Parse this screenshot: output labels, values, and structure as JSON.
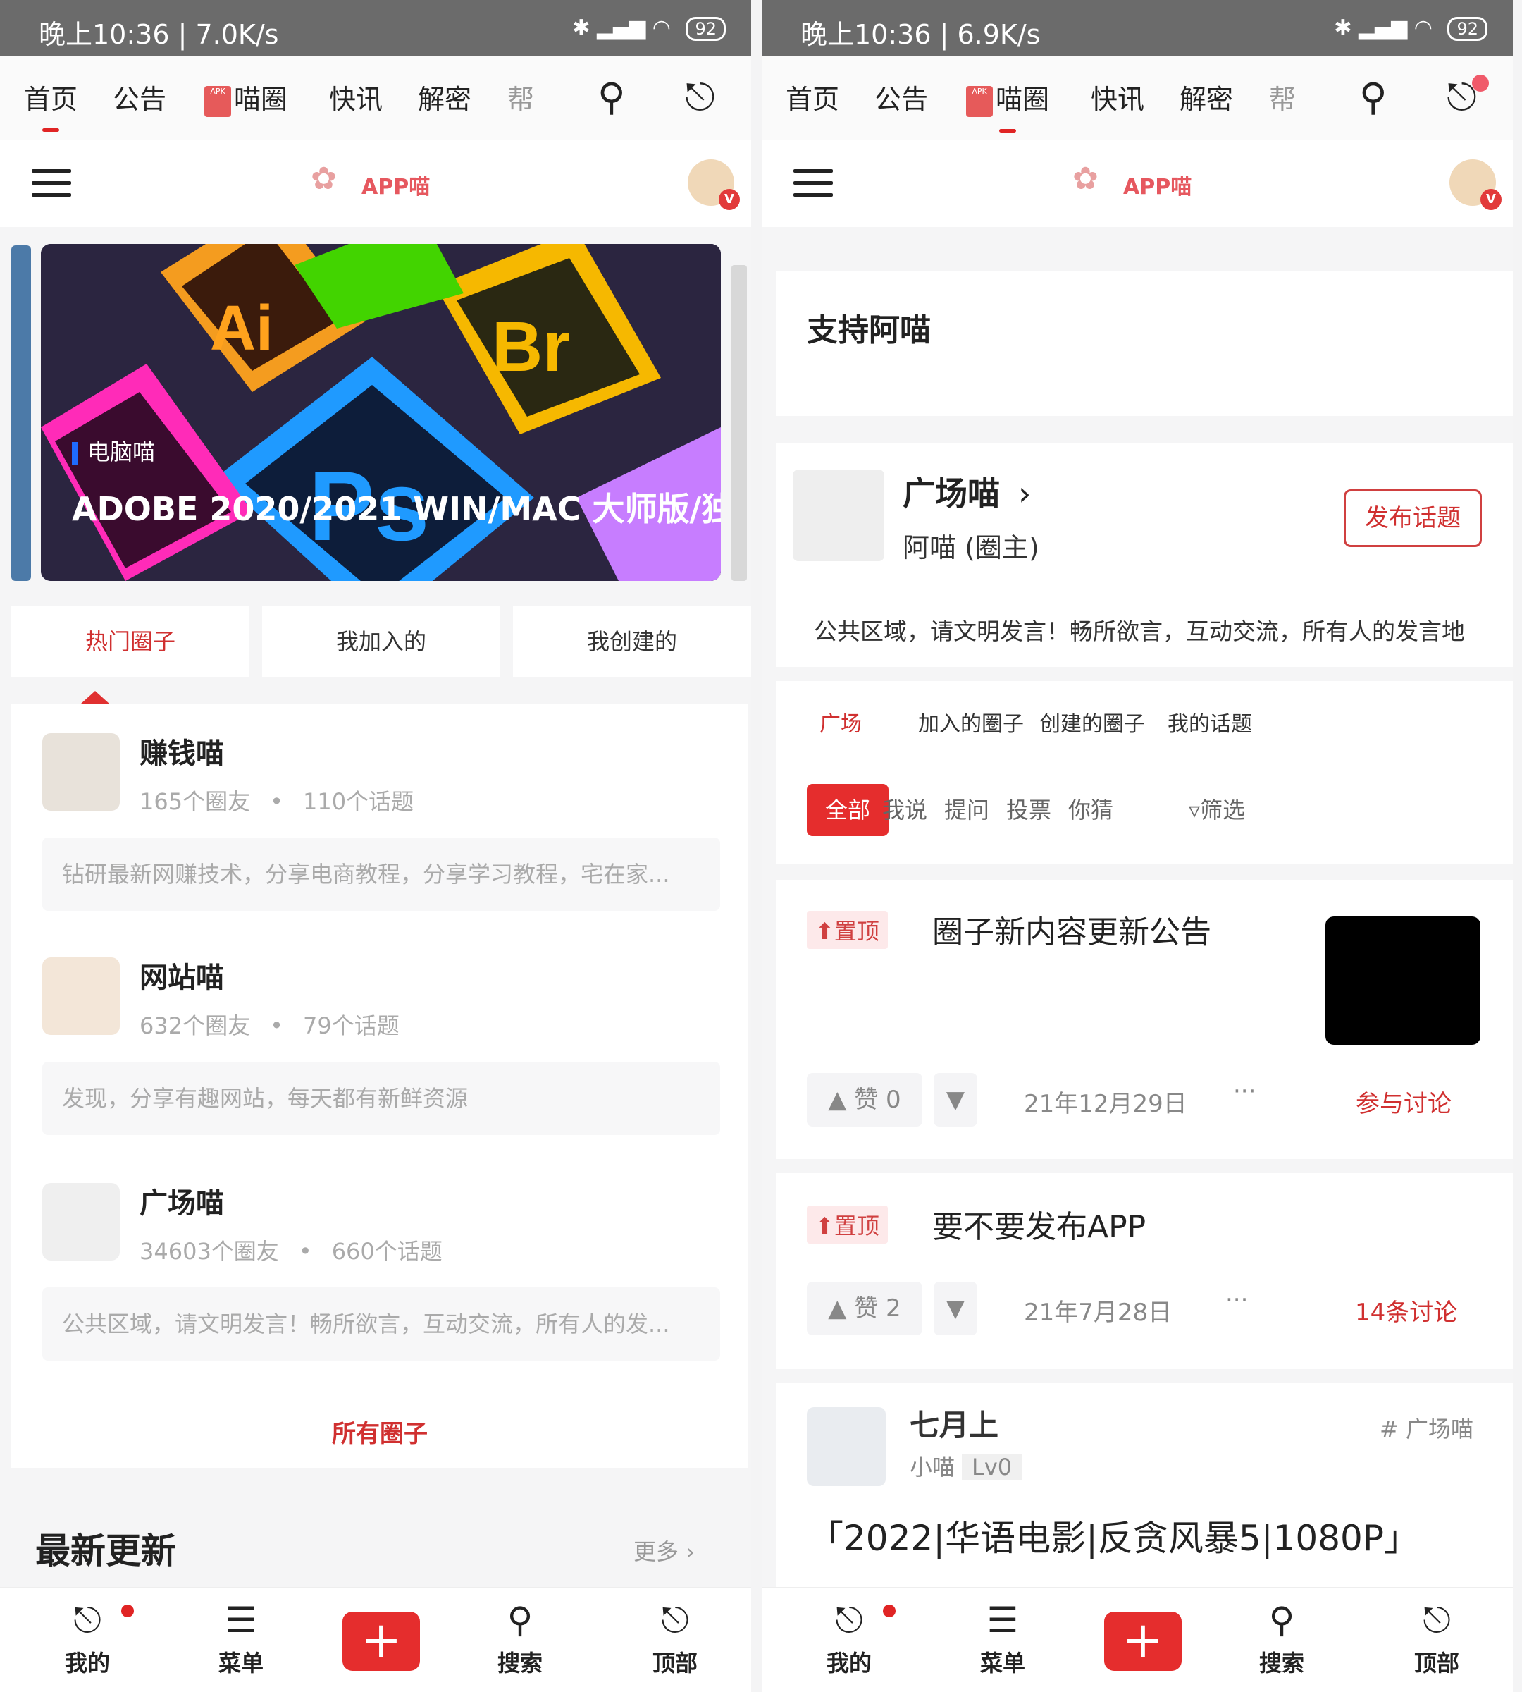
{
  "left": {
    "status": {
      "time": "晚上10:36 | 7.0K/s",
      "battery": "92"
    },
    "topnav": {
      "items": [
        "首页",
        "公告",
        "喵圈",
        "快讯",
        "解密",
        "帮"
      ],
      "apk_label": "APK"
    },
    "brand": {
      "logo_text": "APP喵"
    },
    "banner": {
      "tag": "电脑喵",
      "title": "ADOBE 2020/2021 WIN/MAC 大师版/独..."
    },
    "circle_tabs": [
      "热门圈子",
      "我加入的",
      "我创建的"
    ],
    "circles": [
      {
        "name": "赚钱喵",
        "members": "165个圈友",
        "topics": "110个话题",
        "desc": "钻研最新网赚技术，分享电商教程，分享学习教程，宅在家..."
      },
      {
        "name": "网站喵",
        "members": "632个圈友",
        "topics": "79个话题",
        "desc": "发现，分享有趣网站，每天都有新鲜资源"
      },
      {
        "name": "广场喵",
        "members": "34603个圈友",
        "topics": "660个话题",
        "desc": "公共区域，请文明发言！畅所欲言，互动交流，所有人的发..."
      }
    ],
    "circle_separator": "•",
    "all_circles": "所有圈子",
    "latest": {
      "title": "最新更新",
      "more": "更多 ›"
    }
  },
  "right": {
    "status": {
      "time": "晚上10:36 | 6.9K/s",
      "battery": "92"
    },
    "topnav": {
      "items": [
        "首页",
        "公告",
        "喵圈",
        "快讯",
        "解密",
        "帮"
      ],
      "apk_label": "APK"
    },
    "brand": {
      "logo_text": "APP喵"
    },
    "support_title": "支持阿喵",
    "group": {
      "name": "广场喵",
      "arrow": "›",
      "owner": "阿喵 (圈主)",
      "publish": "发布话题",
      "desc": "公共区域，请文明发言！畅所欲言，互动交流，所有人的发言地"
    },
    "feed_tabs": [
      "广场",
      "加入的圈子",
      "创建的圈子",
      "我的话题"
    ],
    "chips": [
      "全部",
      "我说",
      "提问",
      "投票",
      "你猜"
    ],
    "filter": "筛选",
    "pin_label": "置顶",
    "posts": [
      {
        "title": "圈子新内容更新公告",
        "likes": "赞 0",
        "date": "21年12月29日",
        "more": "···",
        "action": "参与讨论"
      },
      {
        "title": "要不要发布APP",
        "likes": "赞 2",
        "date": "21年7月28日",
        "more": "···",
        "action": "14条讨论"
      }
    ],
    "user_post": {
      "name": "七月上",
      "role": "小喵",
      "level": "Lv0",
      "tag": "广场喵",
      "title": "「2022|华语电影|反贪风暴5|1080P」"
    }
  },
  "bottom_nav": [
    "我的",
    "菜单",
    "搜索",
    "顶部"
  ],
  "colors": {
    "accent": "#e52d2d",
    "status_bar": "#6b6b6b",
    "link_red": "#d03030"
  }
}
